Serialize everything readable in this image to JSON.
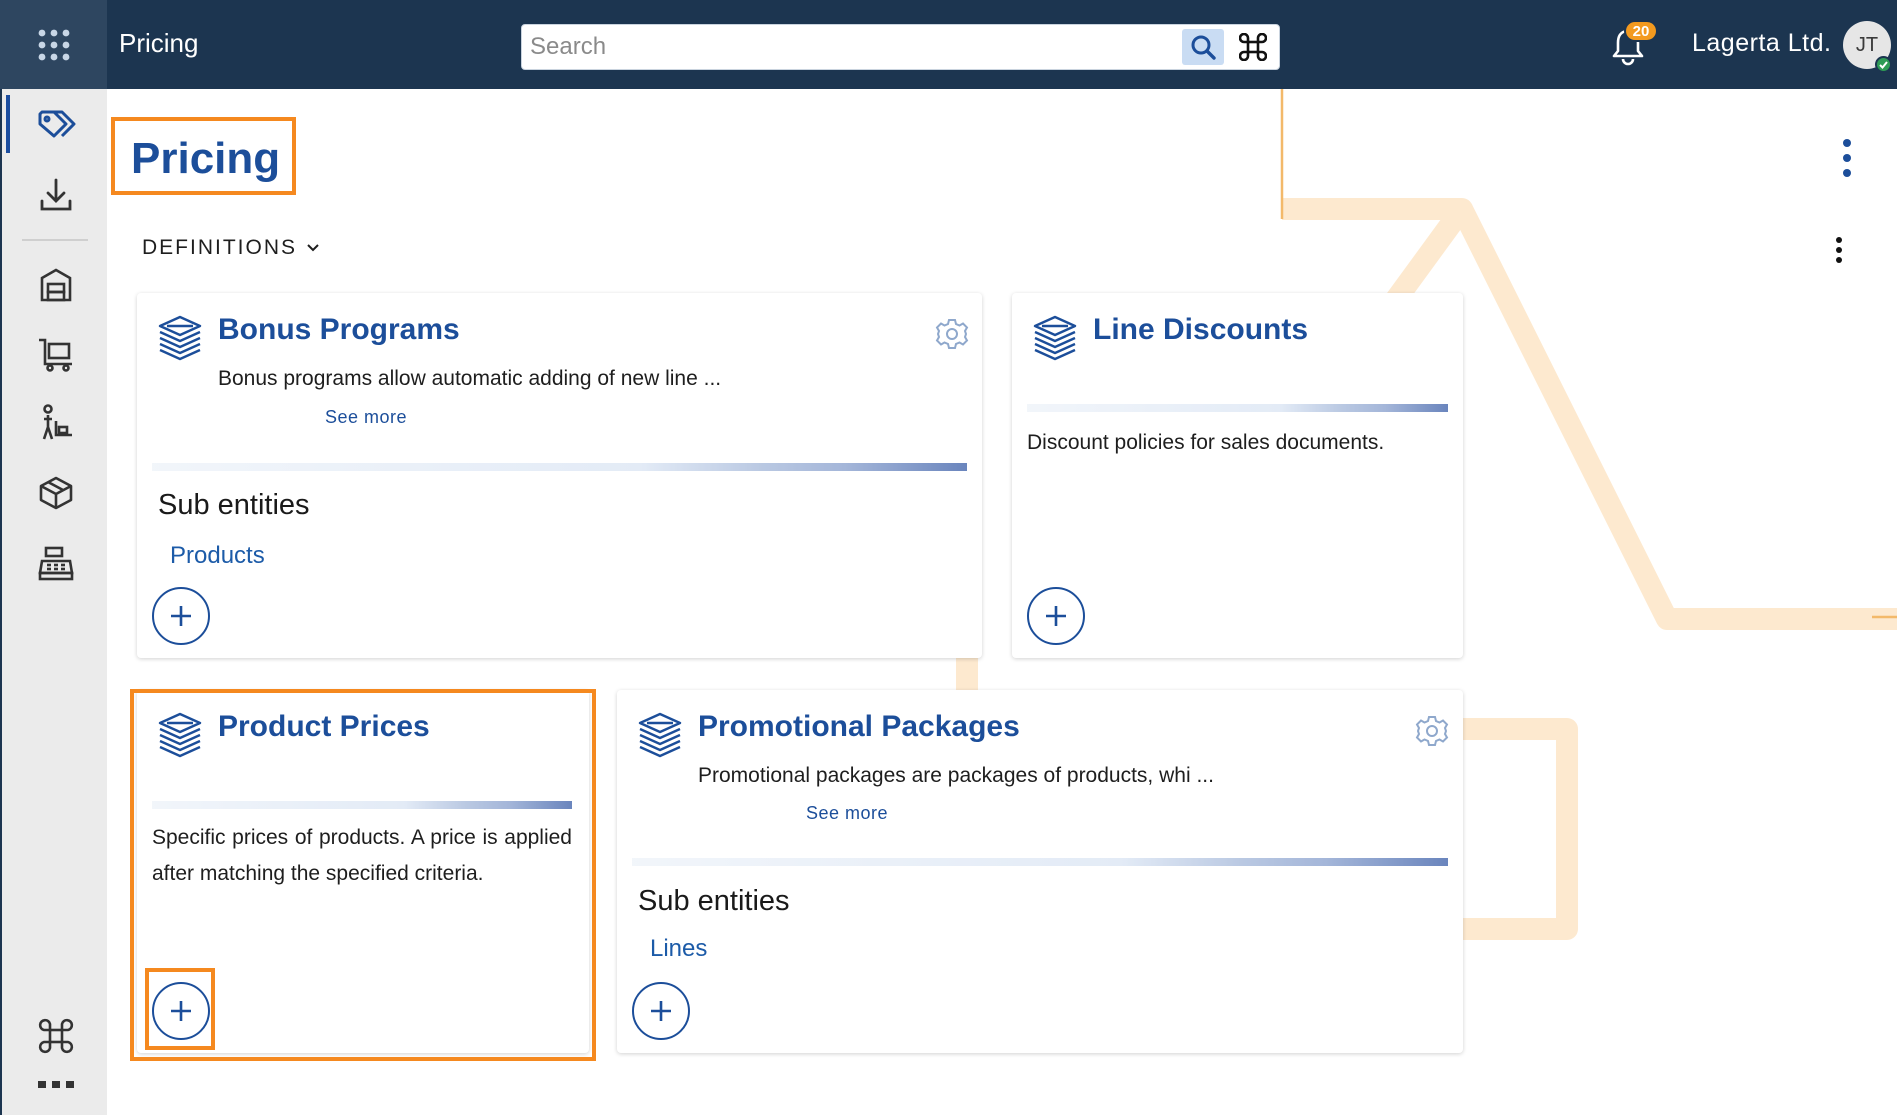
{
  "header": {
    "app_title": "Pricing",
    "search_placeholder": "Search",
    "notification_count": "20",
    "company": "Lagerta Ltd.",
    "user_initials": "JT"
  },
  "sidebar": {
    "items": [
      {
        "name": "pricing-tag-icon",
        "active": true
      },
      {
        "name": "download-icon"
      },
      {
        "name": "warehouse-icon"
      },
      {
        "name": "cart-icon"
      },
      {
        "name": "person-cart-icon"
      },
      {
        "name": "box-icon"
      },
      {
        "name": "cash-register-icon"
      },
      {
        "name": "command-icon"
      },
      {
        "name": "more-icon"
      }
    ]
  },
  "page": {
    "title": "Pricing",
    "section": "DEFINITIONS"
  },
  "cards": {
    "bonus": {
      "title": "Bonus Programs",
      "description": "Bonus programs allow automatic adding of new line  ...",
      "see_more": "See more",
      "sub_heading": "Sub entities",
      "sub_link": "Products"
    },
    "line_discounts": {
      "title": "Line Discounts",
      "description": "Discount policies for sales documents."
    },
    "product_prices": {
      "title": "Product Prices",
      "description": "Specific prices of products. A price is applied after matching the specified criteria."
    },
    "promo": {
      "title": "Promotional Packages",
      "description": "Promotional packages are packages of products, whi ...",
      "see_more": "See more",
      "sub_heading": "Sub entities",
      "sub_link": "Lines"
    }
  },
  "colors": {
    "topbar": "#1c3550",
    "accent": "#1c4e9a",
    "highlight": "#f5891f",
    "badge": "#f39a1f"
  }
}
